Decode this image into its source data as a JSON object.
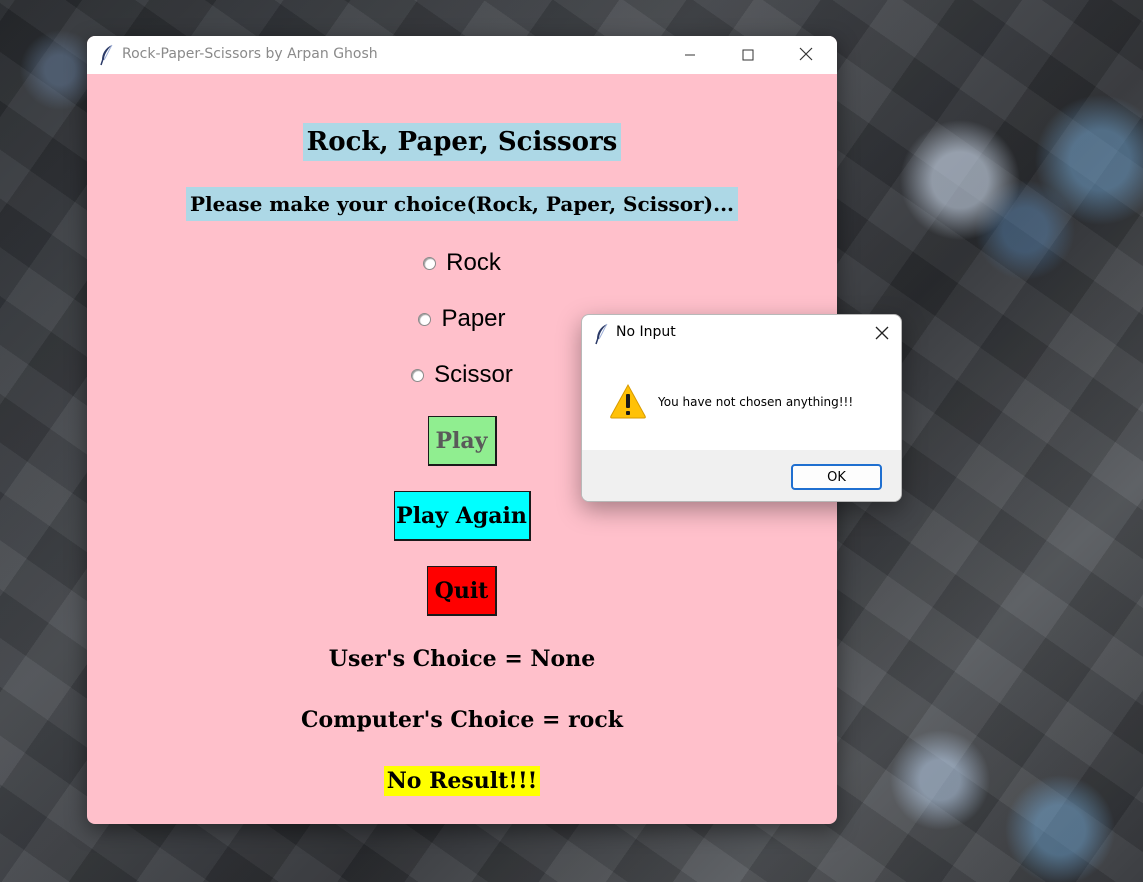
{
  "main_window": {
    "title": "Rock-Paper-Scissors by Arpan Ghosh",
    "heading": "Rock, Paper, Scissors",
    "prompt": "Please make your choice(Rock, Paper, Scissor)...",
    "options": [
      {
        "label": "Rock",
        "selected": false
      },
      {
        "label": "Paper",
        "selected": false
      },
      {
        "label": "Scissor",
        "selected": false
      }
    ],
    "buttons": {
      "play": "Play",
      "play_again": "Play Again",
      "quit": "Quit"
    },
    "user_choice": "User's Choice = None",
    "computer_choice": "Computer's Choice = rock",
    "result": "No Result!!!",
    "colors": {
      "background": "#ffc0cb",
      "heading_bg": "#add8e6",
      "play_bg": "#90ee90",
      "play_again_bg": "#00ffff",
      "quit_bg": "#ff0000",
      "result_bg": "#ffff00"
    },
    "icons": {
      "app": "feather-icon",
      "minimize": "minimize-icon",
      "maximize": "maximize-icon",
      "close": "close-icon"
    }
  },
  "dialog": {
    "title": "No Input",
    "message": "You have not chosen anything!!!",
    "ok_label": "OK",
    "icons": {
      "app": "feather-icon",
      "warning": "warning-icon",
      "close": "close-icon"
    },
    "accent": "#1f6fd0"
  }
}
